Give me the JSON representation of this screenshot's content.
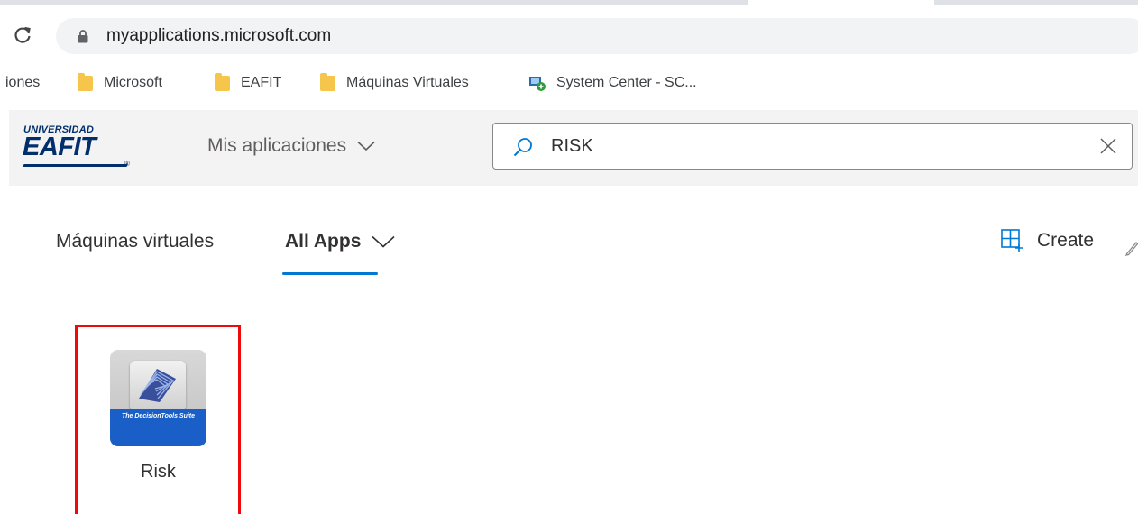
{
  "browser": {
    "url": "myapplications.microsoft.com",
    "bookmarks": [
      {
        "label": "iones",
        "icon": "none"
      },
      {
        "label": "Microsoft",
        "icon": "folder-icon"
      },
      {
        "label": "EAFIT",
        "icon": "folder-icon"
      },
      {
        "label": "Máquinas Virtuales",
        "icon": "folder-icon"
      },
      {
        "label": "System Center - SC...",
        "icon": "system-center-icon"
      }
    ]
  },
  "header": {
    "logo": {
      "top": "UNIVERSIDAD",
      "main": "EAFIT",
      "mark": "®"
    },
    "apps_menu_label": "Mis aplicaciones",
    "search": {
      "value": "RISK"
    }
  },
  "tabs": {
    "items": [
      {
        "label": "Máquinas virtuales",
        "selected": false
      },
      {
        "label": "All Apps",
        "selected": true
      }
    ],
    "create_label": "Create"
  },
  "apps": [
    {
      "label": "Risk",
      "icon_caption": "The DecisionTools Suite"
    }
  ],
  "colors": {
    "accent": "#0078d4",
    "highlight_frame": "#ee0a0a",
    "brand": "#002f6c"
  }
}
